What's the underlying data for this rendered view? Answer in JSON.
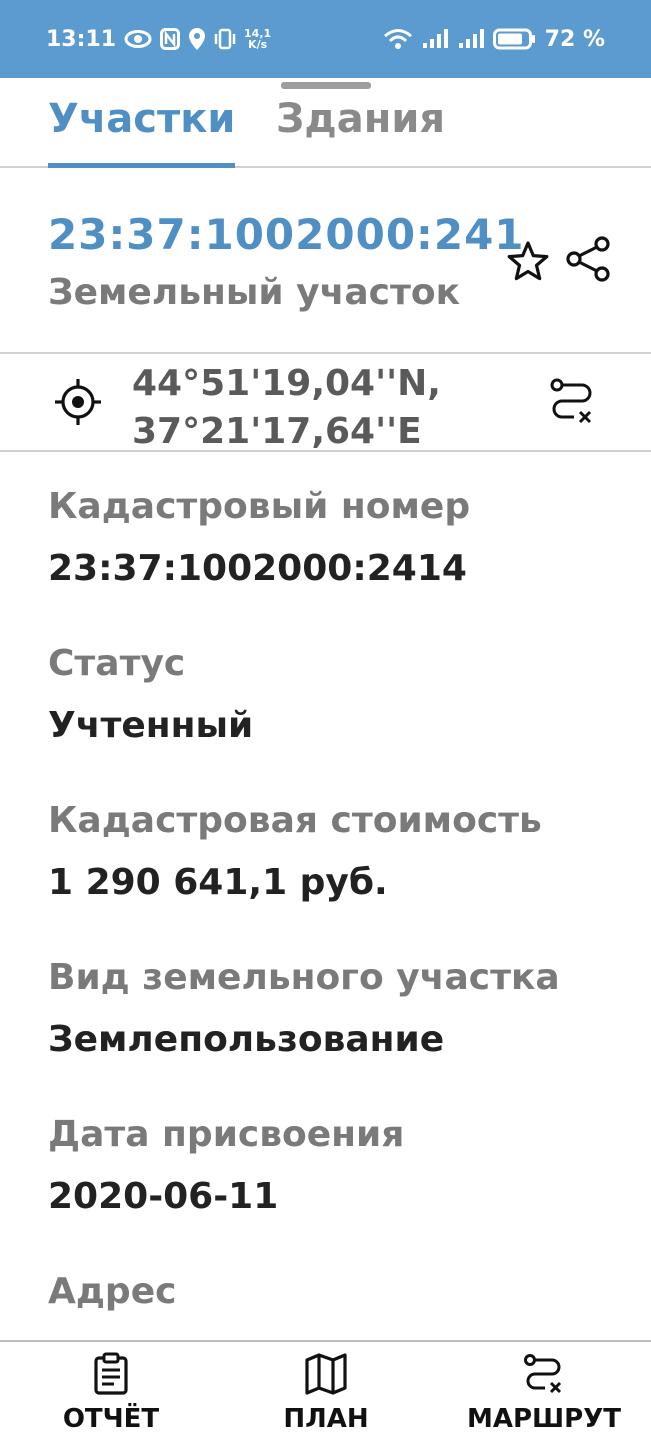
{
  "status_bar": {
    "time": "13:11",
    "net_speed_top": "14,1",
    "net_speed_bottom": "K/s",
    "battery": "72 %",
    "icons": [
      "eye-icon",
      "nfc-icon",
      "location-icon",
      "vibrate-icon",
      "wifi-icon",
      "signal-icon",
      "signal-icon",
      "battery-icon"
    ]
  },
  "tabs": [
    {
      "label": "Участки",
      "active": true
    },
    {
      "label": "Здания",
      "active": false
    }
  ],
  "header": {
    "cadastral_number": "23:37:1002000:2414",
    "object_type": "Земельный участок"
  },
  "coordinates": {
    "lat": "44°51'19,04''N,",
    "lon": "37°21'17,64''E"
  },
  "fields": [
    {
      "label": "Кадастровый номер",
      "value": "23:37:1002000:2414"
    },
    {
      "label": "Статус",
      "value": "Учтенный"
    },
    {
      "label": "Кадастровая стоимость",
      "value": "1 290 641,1 руб."
    },
    {
      "label": "Вид земельного участка",
      "value": "Землепользование"
    },
    {
      "label": "Дата присвоения",
      "value": "2020-06-11"
    },
    {
      "label": "Адрес",
      "value": ""
    }
  ],
  "bottom_nav": {
    "report": "ОТЧЁТ",
    "plan": "ПЛАН",
    "route": "МАРШРУТ"
  },
  "colors": {
    "accent": "#4f8fc4",
    "status_bar": "#5b9bcf",
    "label_gray": "#7a7a7a",
    "value_dark": "#222222"
  }
}
